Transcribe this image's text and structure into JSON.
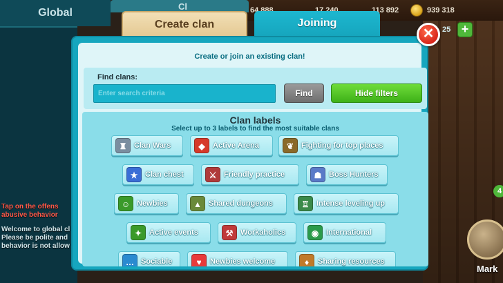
{
  "tabs": {
    "global": "Global",
    "create": "Create clan",
    "joining": "Joining"
  },
  "resources": [
    "64 888",
    "17 240",
    "113 892",
    "939 318"
  ],
  "background": {
    "chat_lines": [
      "Tap on the offens",
      "abusive behavior",
      "Welcome to global cl",
      "Please be polite and",
      "behavior is not allow"
    ],
    "right_badge": "4",
    "right_button_label": "Mark",
    "tab_peek": "Cl",
    "level_peek": "25"
  },
  "dialog": {
    "subtitle": "Create or join an existing clan!",
    "find_label": "Find clans:",
    "search_placeholder": "Enter search criteria",
    "find_button": "Find",
    "hide_filters_button": "Hide filters",
    "labels_title": "Clan labels",
    "labels_subtitle": "Select up to 3 labels to find the most suitable clans",
    "close_glyph": "✕"
  },
  "clan_labels": [
    {
      "label": "Clan Wars",
      "icon": "tower-icon",
      "glyph": "♜",
      "color": "#7a8ea0"
    },
    {
      "label": "Active Arena",
      "icon": "arena-shield-icon",
      "glyph": "◆",
      "color": "#d63a2a"
    },
    {
      "label": "Fighting for top places",
      "icon": "laurel-icon",
      "glyph": "❦",
      "color": "#8a6a2a"
    },
    {
      "label": "Clan chest",
      "icon": "star-chest-icon",
      "glyph": "★",
      "color": "#3a6ed6"
    },
    {
      "label": "Friendly practice",
      "icon": "crossed-swords-icon",
      "glyph": "⚔",
      "color": "#b03a3a"
    },
    {
      "label": "Boss Hunters",
      "icon": "boss-icon",
      "glyph": "☗",
      "color": "#5a7ac8"
    },
    {
      "label": "Newbies",
      "icon": "newbie-face-icon",
      "glyph": "☺",
      "color": "#3a9a2a"
    },
    {
      "label": "Shared dungeons",
      "icon": "dungeon-icon",
      "glyph": "▲",
      "color": "#6a8a3a"
    },
    {
      "label": "Intense leveling up",
      "icon": "castle-icon",
      "glyph": "♖",
      "color": "#3a8a4a"
    },
    {
      "label": "Active events",
      "icon": "events-hero-icon",
      "glyph": "✦",
      "color": "#3a9a2a"
    },
    {
      "label": "Workaholics",
      "icon": "tools-icon",
      "glyph": "⚒",
      "color": "#c03a3a"
    },
    {
      "label": "International",
      "icon": "globe-icon",
      "glyph": "◉",
      "color": "#2a9a4a"
    },
    {
      "label": "Sociable",
      "icon": "chat-bubble-icon",
      "glyph": "…",
      "color": "#2a8ad0"
    },
    {
      "label": "Newbies welcome",
      "icon": "heart-icon",
      "glyph": "♥",
      "color": "#e83a3a"
    },
    {
      "label": "Sharing resources",
      "icon": "resources-icon",
      "glyph": "♦",
      "color": "#c07a2a"
    }
  ]
}
